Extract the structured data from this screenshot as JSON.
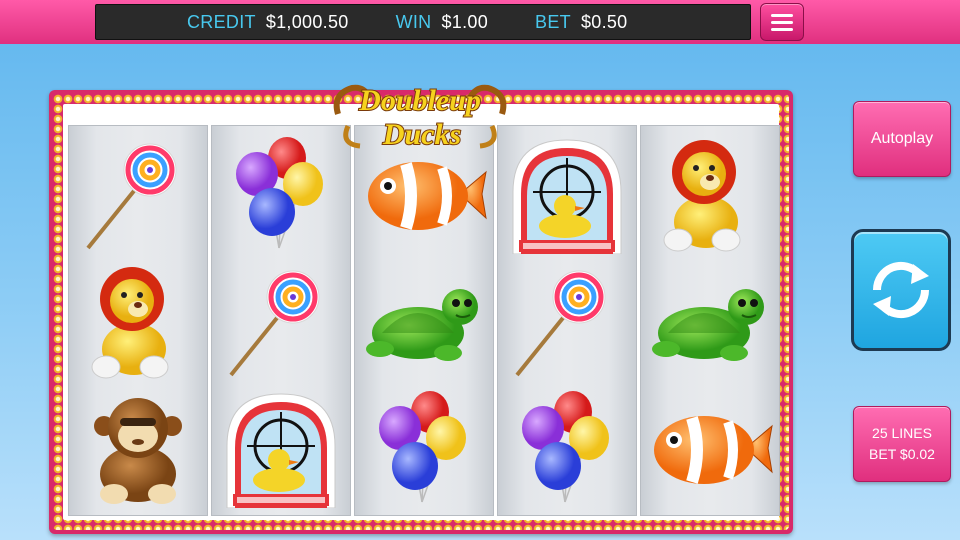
{
  "topbar": {
    "credit_label": "CREDIT",
    "credit_value": "$1,000.50",
    "win_label": "WIN",
    "win_value": "$1.00",
    "bet_label": "BET",
    "bet_value": "$0.50"
  },
  "logo": {
    "line1": "Doubleup",
    "line2": "Ducks"
  },
  "buttons": {
    "autoplay": "Autoplay",
    "lines_label": "25 LINES",
    "bet_label": "BET $0.02",
    "spin_icon": "spin-arrows-icon",
    "menu_icon": "hamburger-menu-icon"
  },
  "reels": [
    [
      "lollipop",
      "lion-plush",
      "monkey-plush"
    ],
    [
      "balloons",
      "lollipop",
      "duck-target"
    ],
    [
      "clownfish-plush",
      "turtle-plush",
      "balloons"
    ],
    [
      "duck-target",
      "lollipop",
      "balloons"
    ],
    [
      "lion-plush",
      "turtle-plush",
      "clownfish-plush"
    ]
  ],
  "colors": {
    "brand_pink": "#e0307f",
    "accent_cyan": "#48c8ee",
    "spin_blue": "#1fa5e0",
    "background_sky": "#8cccf5"
  }
}
